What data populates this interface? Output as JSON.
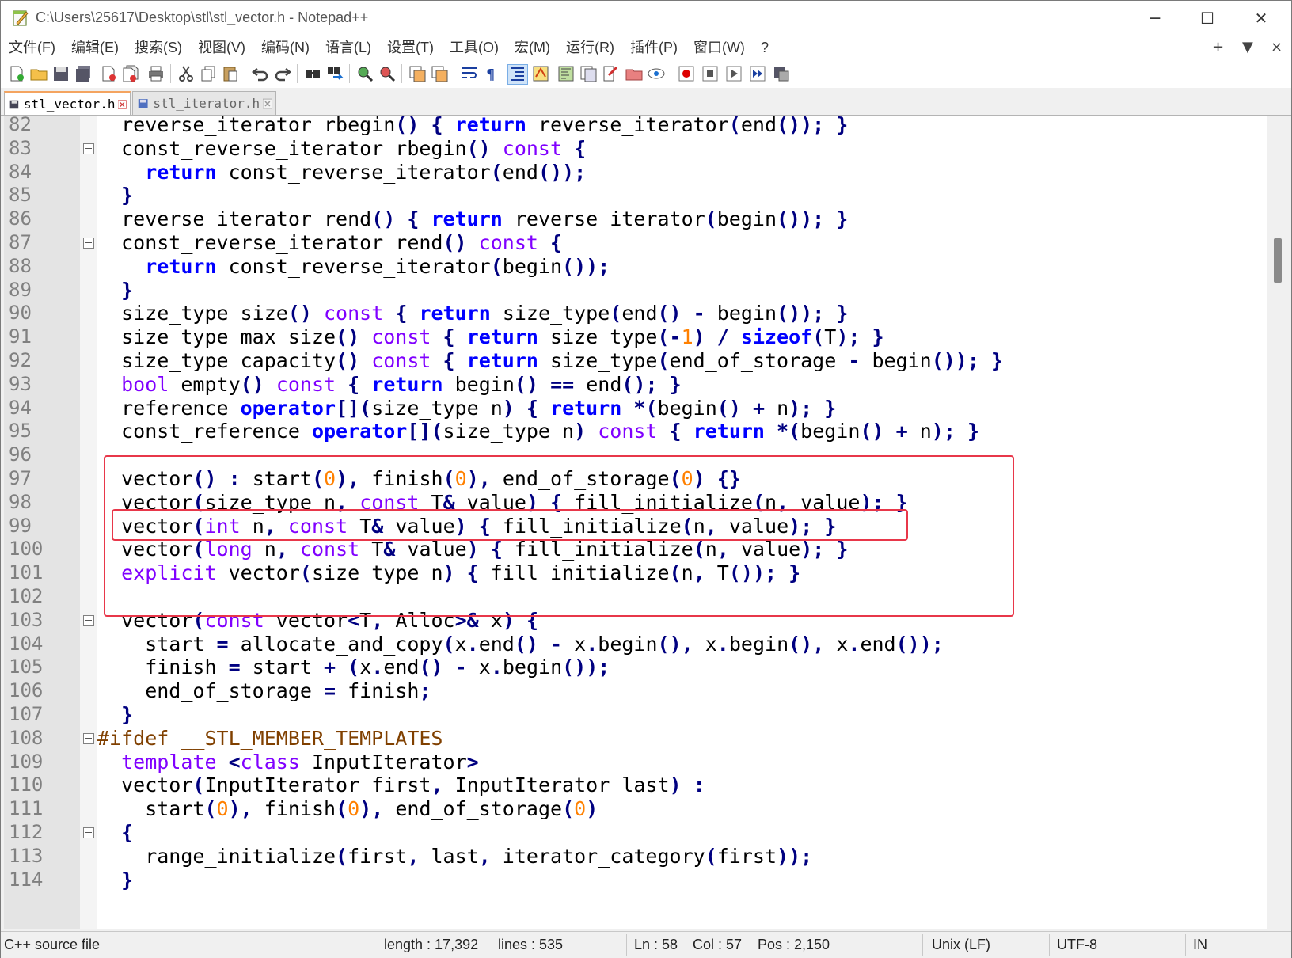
{
  "window": {
    "title": "C:\\Users\\25617\\Desktop\\stl\\stl_vector.h - Notepad++",
    "controls": [
      "─",
      "☐",
      "✕"
    ]
  },
  "menu": {
    "items": [
      "文件(F)",
      "编辑(E)",
      "搜索(S)",
      "视图(V)",
      "编码(N)",
      "语言(L)",
      "设置(T)",
      "工具(O)",
      "宏(M)",
      "运行(R)",
      "插件(P)",
      "窗口(W)",
      "?"
    ],
    "right": [
      "+",
      "▼",
      "×"
    ]
  },
  "toolbar": {
    "icons": [
      "new-file-icon",
      "open-file-icon",
      "save-icon",
      "save-all-icon",
      "close-icon",
      "close-all-icon",
      "print-icon",
      "cut-icon",
      "copy-icon",
      "paste-icon",
      "undo-icon",
      "redo-icon",
      "find-icon",
      "replace-icon",
      "zoom-in-icon",
      "zoom-out-icon",
      "sync-vertical-icon",
      "sync-horizontal-icon",
      "word-wrap-icon",
      "show-all-chars-icon",
      "indent-guide-icon",
      "udl-icon",
      "doc-map-icon",
      "function-list-icon",
      "folder-workspace-icon",
      "monitor-icon",
      "record-macro-icon",
      "stop-macro-icon",
      "play-macro-icon",
      "run-macro-multiple-icon",
      "save-macro-icon"
    ]
  },
  "tabs": [
    {
      "label": "stl_vector.h",
      "active": true
    },
    {
      "label": "stl_iterator.h",
      "active": false
    }
  ],
  "editor": {
    "lines": [
      {
        "n": "82",
        "fold": false,
        "html": "  reverse_iterator rbegin<span class=\"op\">()</span> <span class=\"op\">{</span> <span class=\"kw\">return</span> reverse_iterator<span class=\"op\">(</span>end<span class=\"op\">());</span> <span class=\"op\">}</span>"
      },
      {
        "n": "83",
        "fold": true,
        "html": "  const_reverse_iterator rbegin<span class=\"op\">()</span> <span class=\"ty\">const</span> <span class=\"op\">{</span>"
      },
      {
        "n": "84",
        "fold": false,
        "html": "    <span class=\"kw\">return</span> const_reverse_iterator<span class=\"op\">(</span>end<span class=\"op\">());</span>"
      },
      {
        "n": "85",
        "fold": false,
        "html": "  <span class=\"op\">}</span>"
      },
      {
        "n": "86",
        "fold": false,
        "html": "  reverse_iterator rend<span class=\"op\">()</span> <span class=\"op\">{</span> <span class=\"kw\">return</span> reverse_iterator<span class=\"op\">(</span>begin<span class=\"op\">());</span> <span class=\"op\">}</span>"
      },
      {
        "n": "87",
        "fold": true,
        "html": "  const_reverse_iterator rend<span class=\"op\">()</span> <span class=\"ty\">const</span> <span class=\"op\">{</span>"
      },
      {
        "n": "88",
        "fold": false,
        "html": "    <span class=\"kw\">return</span> const_reverse_iterator<span class=\"op\">(</span>begin<span class=\"op\">());</span>"
      },
      {
        "n": "89",
        "fold": false,
        "html": "  <span class=\"op\">}</span>"
      },
      {
        "n": "90",
        "fold": false,
        "html": "  size_type size<span class=\"op\">()</span> <span class=\"ty\">const</span> <span class=\"op\">{</span> <span class=\"kw\">return</span> size_type<span class=\"op\">(</span>end<span class=\"op\">()</span> <span class=\"op\">-</span> begin<span class=\"op\">());</span> <span class=\"op\">}</span>"
      },
      {
        "n": "91",
        "fold": false,
        "html": "  size_type max_size<span class=\"op\">()</span> <span class=\"ty\">const</span> <span class=\"op\">{</span> <span class=\"kw\">return</span> size_type<span class=\"op\">(-</span><span class=\"num\">1</span><span class=\"op\">)</span> <span class=\"op\">/</span> <span class=\"kw\">sizeof</span><span class=\"op\">(</span>T<span class=\"op\">);</span> <span class=\"op\">}</span>"
      },
      {
        "n": "92",
        "fold": false,
        "html": "  size_type capacity<span class=\"op\">()</span> <span class=\"ty\">const</span> <span class=\"op\">{</span> <span class=\"kw\">return</span> size_type<span class=\"op\">(</span>end_of_storage <span class=\"op\">-</span> begin<span class=\"op\">());</span> <span class=\"op\">}</span>"
      },
      {
        "n": "93",
        "fold": false,
        "html": "  <span class=\"ty\">bool</span> empty<span class=\"op\">()</span> <span class=\"ty\">const</span> <span class=\"op\">{</span> <span class=\"kw\">return</span> begin<span class=\"op\">()</span> <span class=\"op\">==</span> end<span class=\"op\">();</span> <span class=\"op\">}</span>"
      },
      {
        "n": "94",
        "fold": false,
        "html": "  reference <span class=\"kw\">operator</span><span class=\"op\">[](</span>size_type n<span class=\"op\">)</span> <span class=\"op\">{</span> <span class=\"kw\">return</span> <span class=\"op\">*(</span>begin<span class=\"op\">()</span> <span class=\"op\">+</span> n<span class=\"op\">);</span> <span class=\"op\">}</span>"
      },
      {
        "n": "95",
        "fold": false,
        "html": "  const_reference <span class=\"kw\">operator</span><span class=\"op\">[](</span>size_type n<span class=\"op\">)</span> <span class=\"ty\">const</span> <span class=\"op\">{</span> <span class=\"kw\">return</span> <span class=\"op\">*(</span>begin<span class=\"op\">()</span> <span class=\"op\">+</span> n<span class=\"op\">);</span> <span class=\"op\">}</span>"
      },
      {
        "n": "96",
        "fold": false,
        "html": ""
      },
      {
        "n": "97",
        "fold": false,
        "html": "  vector<span class=\"op\">()</span> <span class=\"op\">:</span> start<span class=\"op\">(</span><span class=\"num\">0</span><span class=\"op\">),</span> finish<span class=\"op\">(</span><span class=\"num\">0</span><span class=\"op\">),</span> end_of_storage<span class=\"op\">(</span><span class=\"num\">0</span><span class=\"op\">)</span> <span class=\"op\">{}</span>"
      },
      {
        "n": "98",
        "fold": false,
        "html": "  vector<span class=\"op\">(</span>size_type n<span class=\"op\">,</span> <span class=\"ty\">const</span> T<span class=\"op\">&amp;</span> value<span class=\"op\">)</span> <span class=\"op\">{</span> fill_initialize<span class=\"op\">(</span>n<span class=\"op\">,</span> value<span class=\"op\">);</span> <span class=\"op\">}</span>"
      },
      {
        "n": "99",
        "fold": false,
        "html": "  vector<span class=\"op\">(</span><span class=\"ty\">int</span> n<span class=\"op\">,</span> <span class=\"ty\">const</span> T<span class=\"op\">&amp;</span> value<span class=\"op\">)</span> <span class=\"op\">{</span> fill_initialize<span class=\"op\">(</span>n<span class=\"op\">,</span> value<span class=\"op\">);</span> <span class=\"op\">}</span>"
      },
      {
        "n": "100",
        "fold": false,
        "html": "  vector<span class=\"op\">(</span><span class=\"ty\">long</span> n<span class=\"op\">,</span> <span class=\"ty\">const</span> T<span class=\"op\">&amp;</span> value<span class=\"op\">)</span> <span class=\"op\">{</span> fill_initialize<span class=\"op\">(</span>n<span class=\"op\">,</span> value<span class=\"op\">);</span> <span class=\"op\">}</span>"
      },
      {
        "n": "101",
        "fold": false,
        "html": "  <span class=\"ty\">explicit</span> vector<span class=\"op\">(</span>size_type n<span class=\"op\">)</span> <span class=\"op\">{</span> fill_initialize<span class=\"op\">(</span>n<span class=\"op\">,</span> T<span class=\"op\">());</span> <span class=\"op\">}</span>"
      },
      {
        "n": "102",
        "fold": false,
        "html": ""
      },
      {
        "n": "103",
        "fold": true,
        "html": "  vector<span class=\"op\">(</span><span class=\"ty\">const</span> vector<span class=\"op\">&lt;</span>T<span class=\"op\">,</span> Alloc<span class=\"op\">&gt;&amp;</span> x<span class=\"op\">)</span> <span class=\"op\">{</span>"
      },
      {
        "n": "104",
        "fold": false,
        "html": "    start <span class=\"op\">=</span> allocate_and_copy<span class=\"op\">(</span>x<span class=\"op\">.</span>end<span class=\"op\">()</span> <span class=\"op\">-</span> x<span class=\"op\">.</span>begin<span class=\"op\">(),</span> x<span class=\"op\">.</span>begin<span class=\"op\">(),</span> x<span class=\"op\">.</span>end<span class=\"op\">());</span>"
      },
      {
        "n": "105",
        "fold": false,
        "html": "    finish <span class=\"op\">=</span> start <span class=\"op\">+</span> <span class=\"op\">(</span>x<span class=\"op\">.</span>end<span class=\"op\">()</span> <span class=\"op\">-</span> x<span class=\"op\">.</span>begin<span class=\"op\">());</span>"
      },
      {
        "n": "106",
        "fold": false,
        "html": "    end_of_storage <span class=\"op\">=</span> finish<span class=\"op\">;</span>"
      },
      {
        "n": "107",
        "fold": false,
        "html": "  <span class=\"op\">}</span>"
      },
      {
        "n": "108",
        "fold": true,
        "html": "<span class=\"pp\">#ifdef __STL_MEMBER_TEMPLATES</span>"
      },
      {
        "n": "109",
        "fold": false,
        "html": "  <span class=\"ty\">template</span> <span class=\"op\">&lt;</span><span class=\"ty\">class</span> InputIterator<span class=\"op\">&gt;</span>"
      },
      {
        "n": "110",
        "fold": false,
        "html": "  vector<span class=\"op\">(</span>InputIterator first<span class=\"op\">,</span> InputIterator last<span class=\"op\">)</span> <span class=\"op\">:</span>"
      },
      {
        "n": "111",
        "fold": false,
        "html": "    start<span class=\"op\">(</span><span class=\"num\">0</span><span class=\"op\">),</span> finish<span class=\"op\">(</span><span class=\"num\">0</span><span class=\"op\">),</span> end_of_storage<span class=\"op\">(</span><span class=\"num\">0</span><span class=\"op\">)</span>"
      },
      {
        "n": "112",
        "fold": true,
        "html": "  <span class=\"op\">{</span>"
      },
      {
        "n": "113",
        "fold": false,
        "html": "    range_initialize<span class=\"op\">(</span>first<span class=\"op\">,</span> last<span class=\"op\">,</span> iterator_category<span class=\"op\">(</span>first<span class=\"op\">));</span>"
      },
      {
        "n": "114",
        "fold": false,
        "html": "  <span class=\"op\">}</span>"
      }
    ]
  },
  "status": {
    "file_type": "C++ source file",
    "length": "length : 17,392",
    "lines": "lines : 535",
    "ln": "Ln : 58",
    "col": "Col : 57",
    "pos": "Pos : 2,150",
    "eol": "Unix (LF)",
    "encoding": "UTF-8",
    "ins": "IN"
  },
  "colors": {
    "keyword": "#0000ff",
    "type": "#8000ff",
    "operator": "#000080",
    "number": "#ff8000",
    "preprocessor": "#804000",
    "highlight_box": "#e8374a"
  }
}
